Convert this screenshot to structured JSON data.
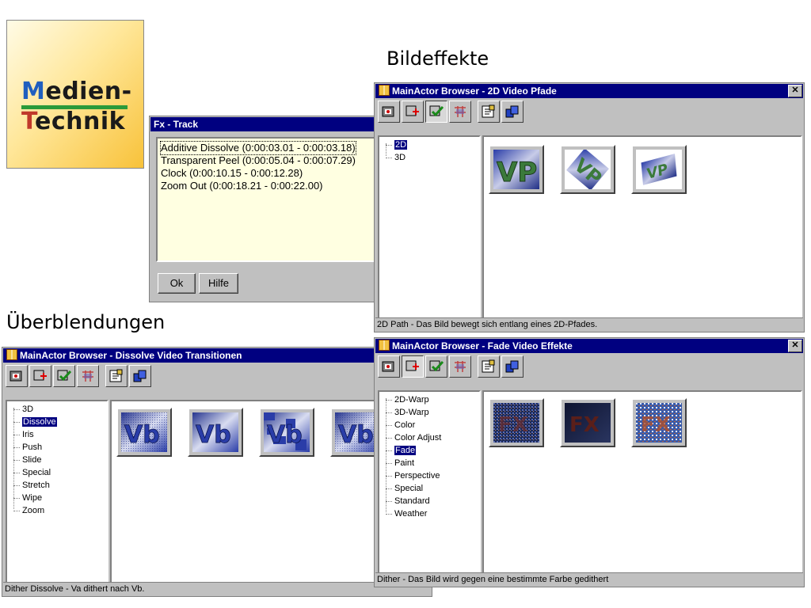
{
  "logo": {
    "line1": "Medien-",
    "line2": "Technik"
  },
  "headings": {
    "top": "Bildeffekte",
    "left": "Überblendungen"
  },
  "fx_track": {
    "title": "Fx - Track",
    "items": [
      "Additive Dissolve (0:00:03.01 - 0:00:03.18)",
      "Transparent Peel (0:00:05.04 - 0:00:07.29)",
      "Clock (0:00:10.15 - 0:00:12.28)",
      "Zoom Out (0:00:18.21 - 0:00:22.00)"
    ],
    "ok_label": "Ok",
    "help_label": "Hilfe"
  },
  "win_2d": {
    "title": "MainActor Browser - 2D Video Pfade",
    "tree": [
      "2D",
      "3D"
    ],
    "selected": "2D",
    "status": "2D Path - Das Bild bewegt sich entlang eines 2D-Pfades."
  },
  "win_dissolve": {
    "title": "MainActor Browser - Dissolve Video Transitionen",
    "tree": [
      "3D",
      "Dissolve",
      "Iris",
      "Push",
      "Slide",
      "Special",
      "Stretch",
      "Wipe",
      "Zoom"
    ],
    "selected": "Dissolve",
    "status": "Dither Dissolve - Va dithert nach Vb."
  },
  "win_fade": {
    "title": "MainActor Browser - Fade Video Effekte",
    "tree": [
      "2D-Warp",
      "3D-Warp",
      "Color",
      "Color Adjust",
      "Fade",
      "Paint",
      "Perspective",
      "Special",
      "Standard",
      "Weather"
    ],
    "selected": "Fade",
    "status": "Dither - Das Bild wird gegen eine bestimmte Farbe gedithert"
  },
  "close_glyph": "✕",
  "toolbar_icons": [
    "video-source-icon",
    "video-add-icon",
    "video-check-icon",
    "transition-icon",
    "text-icon",
    "copy-icon"
  ],
  "thumb_texts": {
    "vb": "Vb",
    "vp": "VP",
    "fx": "FX"
  }
}
